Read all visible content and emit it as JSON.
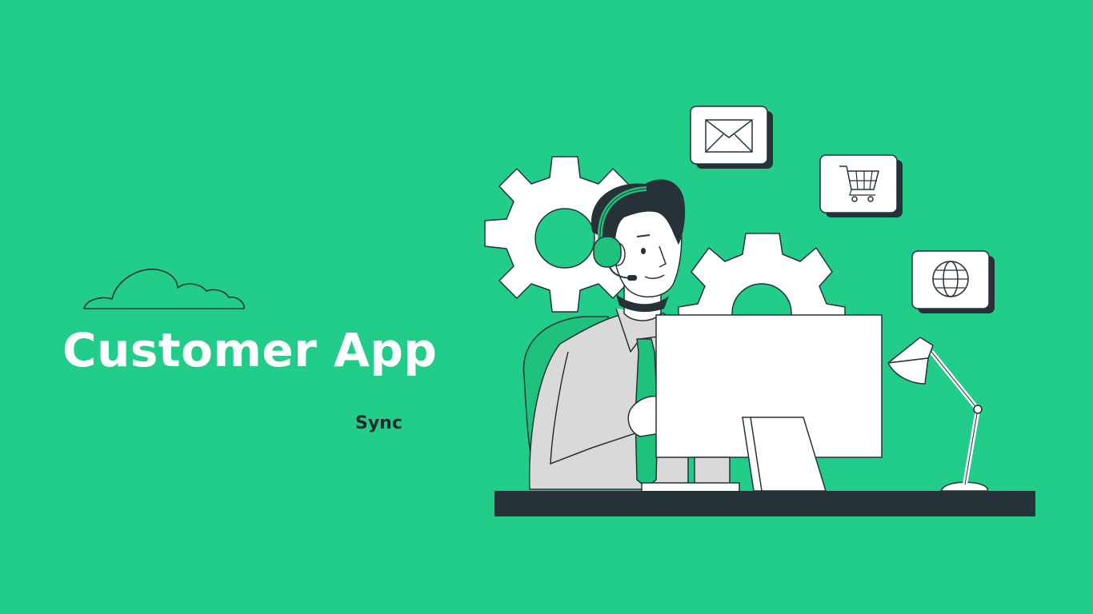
{
  "hero": {
    "title": "Customer App",
    "subtitle": "Sync"
  },
  "illustration": {
    "icons": [
      "mail-icon",
      "shopping-cart-icon",
      "globe-icon",
      "gear-icon",
      "headset-icon",
      "desk-lamp-icon",
      "monitor-icon"
    ]
  },
  "colors": {
    "background": "#22cd89",
    "accent_green": "#1fc27d",
    "dark": "#263238",
    "white": "#ffffff",
    "shirt_gray": "#d9d9d9"
  }
}
